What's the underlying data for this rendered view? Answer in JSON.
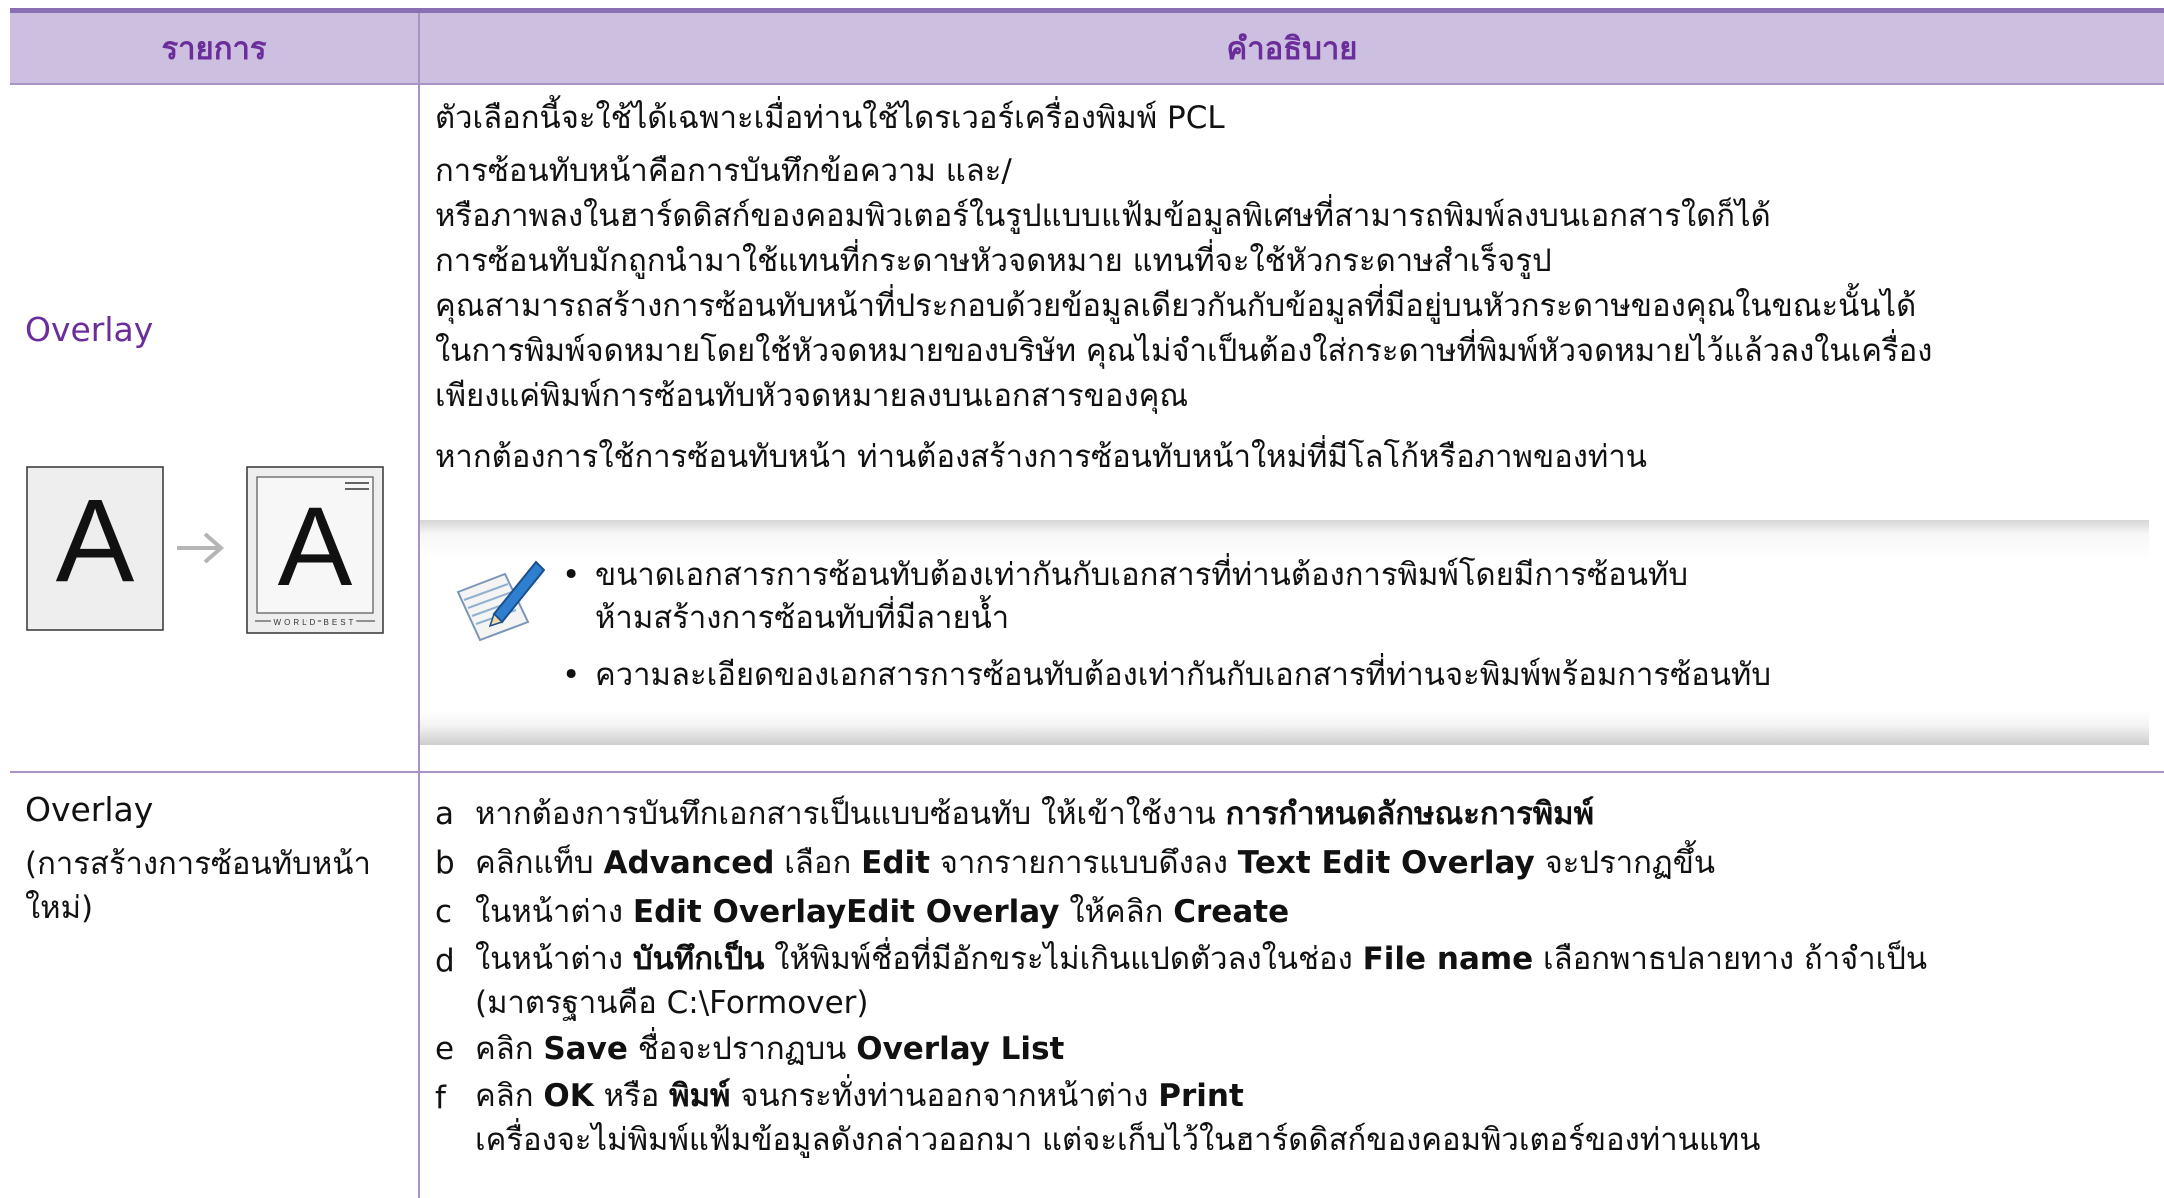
{
  "header": {
    "col1": "รายการ",
    "col2": "คำอธิบาย"
  },
  "row1": {
    "item": "Overlay",
    "illustration": {
      "left_letter": "A",
      "right_letter": "A",
      "footer_text": "WORLD BEST",
      "arrow": "→"
    },
    "p1": "ตัวเลือกนี้จะใช้ได้เฉพาะเมื่อท่านใช้ไดรเวอร์เครื่องพิมพ์ PCL",
    "p2_lines": [
      "การซ้อนทับหน้าคือการบันทึกข้อความ และ/",
      "หรือภาพลงในฮาร์ดดิสก์ของคอมพิวเตอร์ในรูปแบบแฟ้มข้อมูลพิเศษที่สามารถพิมพ์ลงบนเอกสารใดก็ได้",
      "การซ้อนทับมักถูกนำมาใช้แทนที่กระดาษหัวจดหมาย แทนที่จะใช้หัวกระดาษสำเร็จรูป",
      "คุณสามารถสร้างการซ้อนทับหน้าที่ประกอบด้วยข้อมูลเดียวกันกับข้อมูลที่มีอยู่บนหัวกระดาษของคุณในขณะนั้นได้",
      "ในการพิมพ์จดหมายโดยใช้หัวจดหมายของบริษัท คุณไม่จำเป็นต้องใส่กระดาษที่พิมพ์หัวจดหมายไว้แล้วลงในเครื่อง",
      "เพียงแค่พิมพ์การซ้อนทับหัวจดหมายลงบนเอกสารของคุณ"
    ],
    "p3": "หากต้องการใช้การซ้อนทับหน้า ท่านต้องสร้างการซ้อนทับหน้าใหม่ที่มีโลโก้หรือภาพของท่าน",
    "note": {
      "bullet1_line1": "ขนาดเอกสารการซ้อนทับต้องเท่ากันกับเอกสารที่ท่านต้องการพิมพ์โดยมีการซ้อนทับ",
      "bullet1_line2": "ห้ามสร้างการซ้อนทับที่มีลายน้ำ",
      "bullet2": "ความละเอียดของเอกสารการซ้อนทับต้องเท่ากันกับเอกสารที่ท่านจะพิมพ์พร้อมการซ้อนทับ"
    }
  },
  "row2": {
    "item": "Overlay",
    "item_sub_line1": "(การสร้างการซ้อนทับหน้า",
    "item_sub_line2": "ใหม่)",
    "steps": {
      "a": {
        "letter": "a",
        "t1": "หากต้องการบันทึกเอกสารเป็นแบบซ้อนทับ ให้เข้าใช้งาน ",
        "b1": "การกำหนดลักษณะการพิมพ์"
      },
      "b": {
        "letter": "b",
        "t1": "คลิกแท็บ ",
        "b1": "Advanced",
        "t2": " เลือก ",
        "b2": "Edit",
        "t3": " จากรายการแบบดึงลง ",
        "b3": "Text Edit Overlay",
        "t4": " จะปรากฏขึ้น"
      },
      "c": {
        "letter": "c",
        "t1": "ในหน้าต่าง ",
        "b1": "Edit OverlayEdit Overlay",
        "t2": " ให้คลิก ",
        "b2": "Create"
      },
      "d": {
        "letter": "d",
        "t1": "ในหน้าต่าง ",
        "b1": "บันทึกเป็น",
        "t2": " ให้พิมพ์ชื่อที่มีอักขระไม่เกินแปดตัวลงในช่อง ",
        "b2": "File name",
        "t3": " เลือกพาธปลายทาง ถ้าจำเป็น",
        "line2": "(มาตรฐานคือ C:\\Formover)"
      },
      "e": {
        "letter": "e",
        "t1": "คลิก ",
        "b1": "Save",
        "t2": " ชื่อจะปรากฏบน ",
        "b2": "Overlay List"
      },
      "f": {
        "letter": "f",
        "t1": "คลิก ",
        "b1": "OK",
        "t2": " หรือ ",
        "b2": "พิมพ์",
        "t3": " จนกระทั่งท่านออกจากหน้าต่าง ",
        "b3": "Print",
        "line2": "เครื่องจะไม่พิมพ์แฟ้มข้อมูลดังกล่าวออกมา แต่จะเก็บไว้ในฮาร์ดดิสก์ของคอมพิวเตอร์ของท่านแทน"
      }
    }
  },
  "colors": {
    "header_bg": "#cdbfe0",
    "header_text": "#6b2d9a",
    "rule": "#8b6fb5",
    "border": "#a793c6"
  }
}
